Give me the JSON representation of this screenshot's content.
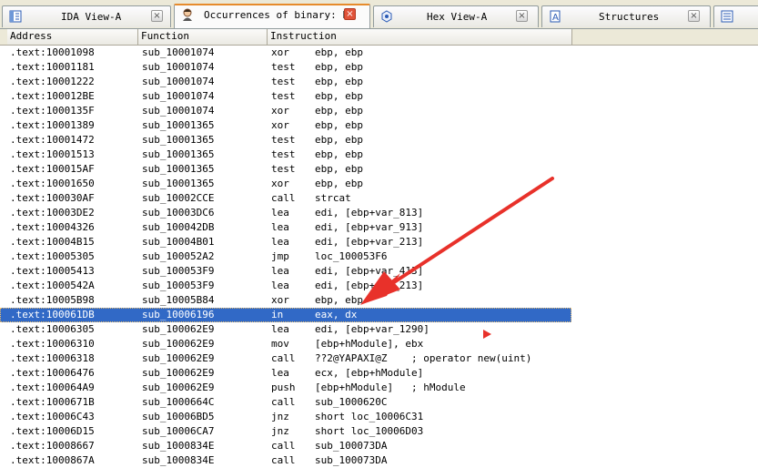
{
  "tabs": [
    {
      "label": "IDA View-A",
      "icon": "ida-view-icon",
      "active": false
    },
    {
      "label": "Occurrences of binary: ED",
      "icon": "person-icon",
      "active": true
    },
    {
      "label": "Hex View-A",
      "icon": "hex-view-icon",
      "active": false
    },
    {
      "label": "Structures",
      "icon": "structures-icon",
      "active": false
    },
    {
      "label": "",
      "icon": "enums-icon",
      "active": false
    }
  ],
  "close_glyph": "×",
  "columns": {
    "address": "Address",
    "function": "Function",
    "instruction": "Instruction"
  },
  "rows": [
    {
      "address": ".text:10001098",
      "function": "sub_10001074",
      "mnemonic": "xor",
      "operands": "ebp, ebp"
    },
    {
      "address": ".text:10001181",
      "function": "sub_10001074",
      "mnemonic": "test",
      "operands": "ebp, ebp"
    },
    {
      "address": ".text:10001222",
      "function": "sub_10001074",
      "mnemonic": "test",
      "operands": "ebp, ebp"
    },
    {
      "address": ".text:100012BE",
      "function": "sub_10001074",
      "mnemonic": "test",
      "operands": "ebp, ebp"
    },
    {
      "address": ".text:1000135F",
      "function": "sub_10001074",
      "mnemonic": "xor",
      "operands": "ebp, ebp"
    },
    {
      "address": ".text:10001389",
      "function": "sub_10001365",
      "mnemonic": "xor",
      "operands": "ebp, ebp"
    },
    {
      "address": ".text:10001472",
      "function": "sub_10001365",
      "mnemonic": "test",
      "operands": "ebp, ebp"
    },
    {
      "address": ".text:10001513",
      "function": "sub_10001365",
      "mnemonic": "test",
      "operands": "ebp, ebp"
    },
    {
      "address": ".text:100015AF",
      "function": "sub_10001365",
      "mnemonic": "test",
      "operands": "ebp, ebp"
    },
    {
      "address": ".text:10001650",
      "function": "sub_10001365",
      "mnemonic": "xor",
      "operands": "ebp, ebp"
    },
    {
      "address": ".text:100030AF",
      "function": "sub_10002CCE",
      "mnemonic": "call",
      "operands": "strcat"
    },
    {
      "address": ".text:10003DE2",
      "function": "sub_10003DC6",
      "mnemonic": "lea",
      "operands": "edi, [ebp+var_813]"
    },
    {
      "address": ".text:10004326",
      "function": "sub_100042DB",
      "mnemonic": "lea",
      "operands": "edi, [ebp+var_913]"
    },
    {
      "address": ".text:10004B15",
      "function": "sub_10004B01",
      "mnemonic": "lea",
      "operands": "edi, [ebp+var_213]"
    },
    {
      "address": ".text:10005305",
      "function": "sub_100052A2",
      "mnemonic": "jmp",
      "operands": "loc_100053F6"
    },
    {
      "address": ".text:10005413",
      "function": "sub_100053F9",
      "mnemonic": "lea",
      "operands": "edi, [ebp+var_413]"
    },
    {
      "address": ".text:1000542A",
      "function": "sub_100053F9",
      "mnemonic": "lea",
      "operands": "edi, [ebp+var_213]"
    },
    {
      "address": ".text:10005B98",
      "function": "sub_10005B84",
      "mnemonic": "xor",
      "operands": "ebp, ebp"
    },
    {
      "address": ".text:100061DB",
      "function": "sub_10006196",
      "mnemonic": "in",
      "operands": "eax, dx",
      "selected": true
    },
    {
      "address": ".text:10006305",
      "function": "sub_100062E9",
      "mnemonic": "lea",
      "operands": "edi, [ebp+var_1290]"
    },
    {
      "address": ".text:10006310",
      "function": "sub_100062E9",
      "mnemonic": "mov",
      "operands": "[ebp+hModule], ebx"
    },
    {
      "address": ".text:10006318",
      "function": "sub_100062E9",
      "mnemonic": "call",
      "operands": "??2@YAPAXI@Z    ; operator new(uint)"
    },
    {
      "address": ".text:10006476",
      "function": "sub_100062E9",
      "mnemonic": "lea",
      "operands": "ecx, [ebp+hModule]"
    },
    {
      "address": ".text:100064A9",
      "function": "sub_100062E9",
      "mnemonic": "push",
      "operands": "[ebp+hModule]   ; hModule"
    },
    {
      "address": ".text:1000671B",
      "function": "sub_1000664C",
      "mnemonic": "call",
      "operands": "sub_1000620C"
    },
    {
      "address": ".text:10006C43",
      "function": "sub_10006BD5",
      "mnemonic": "jnz",
      "operands": "short loc_10006C31"
    },
    {
      "address": ".text:10006D15",
      "function": "sub_10006CA7",
      "mnemonic": "jnz",
      "operands": "short loc_10006D03"
    },
    {
      "address": ".text:10008667",
      "function": "sub_1000834E",
      "mnemonic": "call",
      "operands": "sub_100073DA"
    },
    {
      "address": ".text:1000867A",
      "function": "sub_1000834E",
      "mnemonic": "call",
      "operands": "sub_100073DA"
    }
  ],
  "colors": {
    "selection": "#3169c6",
    "annotation_arrow": "#e8312a",
    "active_tab_accent": "#e68b2c"
  }
}
